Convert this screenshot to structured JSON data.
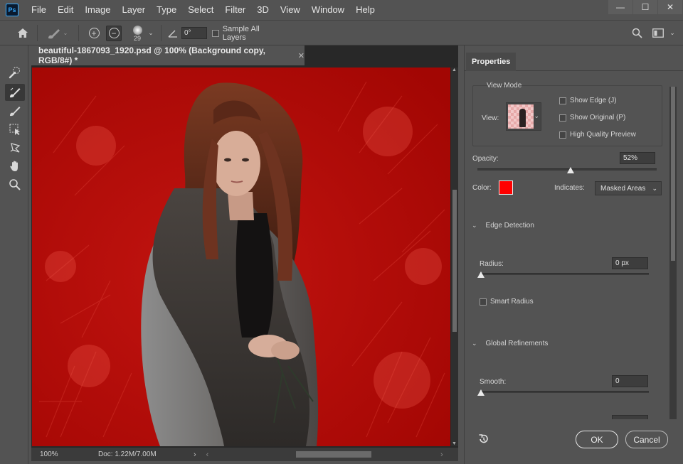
{
  "app": {
    "logo": "Ps"
  },
  "menu": [
    "File",
    "Edit",
    "Image",
    "Layer",
    "Type",
    "Select",
    "Filter",
    "3D",
    "View",
    "Window",
    "Help"
  ],
  "window_controls": {
    "minimize": "—",
    "maximize": "☐",
    "close": "✕"
  },
  "options_bar": {
    "brush_size": "29",
    "angle": "0°",
    "sample_all_layers": "Sample All Layers",
    "sample_all_layers_checked": false
  },
  "tools": [
    "quick-selection-tool",
    "refine-edge-brush-tool",
    "brush-tool",
    "object-selection-tool",
    "lasso-tool",
    "hand-tool",
    "zoom-tool"
  ],
  "document": {
    "tab_title": "beautiful-1867093_1920.psd @ 100% (Background copy, RGB/8#) *",
    "close": "✕",
    "overlay_color": "#b00a04",
    "zoom": "100%",
    "doc_size": "Doc: 1.22M/7.00M"
  },
  "properties": {
    "tab": "Properties",
    "view_mode": {
      "title": "View Mode",
      "view_label": "View:",
      "show_edge": "Show Edge (J)",
      "show_original": "Show Original (P)",
      "high_quality_preview": "High Quality Preview"
    },
    "opacity": {
      "label": "Opacity:",
      "value": "52%",
      "fraction": 0.52
    },
    "color": {
      "label": "Color:",
      "value": "#ff0000"
    },
    "indicates": {
      "label": "Indicates:",
      "value": "Masked Areas"
    },
    "edge_detection": {
      "title": "Edge Detection",
      "radius_label": "Radius:",
      "radius_value": "0 px",
      "radius_fraction": 0,
      "smart_radius": "Smart Radius"
    },
    "global_refinements": {
      "title": "Global Refinements",
      "smooth_label": "Smooth:",
      "smooth_value": "0",
      "smooth_fraction": 0
    },
    "buttons": {
      "ok": "OK",
      "cancel": "Cancel"
    }
  }
}
